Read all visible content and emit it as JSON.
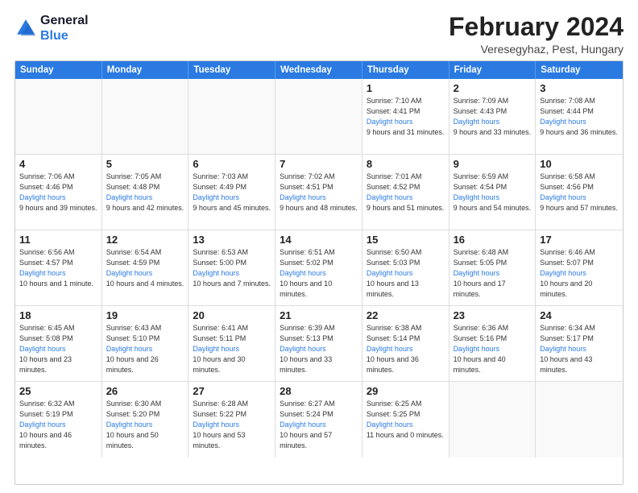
{
  "logo": {
    "line1": "General",
    "line2": "Blue"
  },
  "title": "February 2024",
  "subtitle": "Veresegyhaz, Pest, Hungary",
  "days_of_week": [
    "Sunday",
    "Monday",
    "Tuesday",
    "Wednesday",
    "Thursday",
    "Friday",
    "Saturday"
  ],
  "weeks": [
    [
      {
        "day": "",
        "sunrise": "",
        "sunset": "",
        "daylight": ""
      },
      {
        "day": "",
        "sunrise": "",
        "sunset": "",
        "daylight": ""
      },
      {
        "day": "",
        "sunrise": "",
        "sunset": "",
        "daylight": ""
      },
      {
        "day": "",
        "sunrise": "",
        "sunset": "",
        "daylight": ""
      },
      {
        "day": "1",
        "sunrise": "Sunrise: 7:10 AM",
        "sunset": "Sunset: 4:41 PM",
        "daylight": "Daylight: 9 hours and 31 minutes."
      },
      {
        "day": "2",
        "sunrise": "Sunrise: 7:09 AM",
        "sunset": "Sunset: 4:43 PM",
        "daylight": "Daylight: 9 hours and 33 minutes."
      },
      {
        "day": "3",
        "sunrise": "Sunrise: 7:08 AM",
        "sunset": "Sunset: 4:44 PM",
        "daylight": "Daylight: 9 hours and 36 minutes."
      }
    ],
    [
      {
        "day": "4",
        "sunrise": "Sunrise: 7:06 AM",
        "sunset": "Sunset: 4:46 PM",
        "daylight": "Daylight: 9 hours and 39 minutes."
      },
      {
        "day": "5",
        "sunrise": "Sunrise: 7:05 AM",
        "sunset": "Sunset: 4:48 PM",
        "daylight": "Daylight: 9 hours and 42 minutes."
      },
      {
        "day": "6",
        "sunrise": "Sunrise: 7:03 AM",
        "sunset": "Sunset: 4:49 PM",
        "daylight": "Daylight: 9 hours and 45 minutes."
      },
      {
        "day": "7",
        "sunrise": "Sunrise: 7:02 AM",
        "sunset": "Sunset: 4:51 PM",
        "daylight": "Daylight: 9 hours and 48 minutes."
      },
      {
        "day": "8",
        "sunrise": "Sunrise: 7:01 AM",
        "sunset": "Sunset: 4:52 PM",
        "daylight": "Daylight: 9 hours and 51 minutes."
      },
      {
        "day": "9",
        "sunrise": "Sunrise: 6:59 AM",
        "sunset": "Sunset: 4:54 PM",
        "daylight": "Daylight: 9 hours and 54 minutes."
      },
      {
        "day": "10",
        "sunrise": "Sunrise: 6:58 AM",
        "sunset": "Sunset: 4:56 PM",
        "daylight": "Daylight: 9 hours and 57 minutes."
      }
    ],
    [
      {
        "day": "11",
        "sunrise": "Sunrise: 6:56 AM",
        "sunset": "Sunset: 4:57 PM",
        "daylight": "Daylight: 10 hours and 1 minute."
      },
      {
        "day": "12",
        "sunrise": "Sunrise: 6:54 AM",
        "sunset": "Sunset: 4:59 PM",
        "daylight": "Daylight: 10 hours and 4 minutes."
      },
      {
        "day": "13",
        "sunrise": "Sunrise: 6:53 AM",
        "sunset": "Sunset: 5:00 PM",
        "daylight": "Daylight: 10 hours and 7 minutes."
      },
      {
        "day": "14",
        "sunrise": "Sunrise: 6:51 AM",
        "sunset": "Sunset: 5:02 PM",
        "daylight": "Daylight: 10 hours and 10 minutes."
      },
      {
        "day": "15",
        "sunrise": "Sunrise: 6:50 AM",
        "sunset": "Sunset: 5:03 PM",
        "daylight": "Daylight: 10 hours and 13 minutes."
      },
      {
        "day": "16",
        "sunrise": "Sunrise: 6:48 AM",
        "sunset": "Sunset: 5:05 PM",
        "daylight": "Daylight: 10 hours and 17 minutes."
      },
      {
        "day": "17",
        "sunrise": "Sunrise: 6:46 AM",
        "sunset": "Sunset: 5:07 PM",
        "daylight": "Daylight: 10 hours and 20 minutes."
      }
    ],
    [
      {
        "day": "18",
        "sunrise": "Sunrise: 6:45 AM",
        "sunset": "Sunset: 5:08 PM",
        "daylight": "Daylight: 10 hours and 23 minutes."
      },
      {
        "day": "19",
        "sunrise": "Sunrise: 6:43 AM",
        "sunset": "Sunset: 5:10 PM",
        "daylight": "Daylight: 10 hours and 26 minutes."
      },
      {
        "day": "20",
        "sunrise": "Sunrise: 6:41 AM",
        "sunset": "Sunset: 5:11 PM",
        "daylight": "Daylight: 10 hours and 30 minutes."
      },
      {
        "day": "21",
        "sunrise": "Sunrise: 6:39 AM",
        "sunset": "Sunset: 5:13 PM",
        "daylight": "Daylight: 10 hours and 33 minutes."
      },
      {
        "day": "22",
        "sunrise": "Sunrise: 6:38 AM",
        "sunset": "Sunset: 5:14 PM",
        "daylight": "Daylight: 10 hours and 36 minutes."
      },
      {
        "day": "23",
        "sunrise": "Sunrise: 6:36 AM",
        "sunset": "Sunset: 5:16 PM",
        "daylight": "Daylight: 10 hours and 40 minutes."
      },
      {
        "day": "24",
        "sunrise": "Sunrise: 6:34 AM",
        "sunset": "Sunset: 5:17 PM",
        "daylight": "Daylight: 10 hours and 43 minutes."
      }
    ],
    [
      {
        "day": "25",
        "sunrise": "Sunrise: 6:32 AM",
        "sunset": "Sunset: 5:19 PM",
        "daylight": "Daylight: 10 hours and 46 minutes."
      },
      {
        "day": "26",
        "sunrise": "Sunrise: 6:30 AM",
        "sunset": "Sunset: 5:20 PM",
        "daylight": "Daylight: 10 hours and 50 minutes."
      },
      {
        "day": "27",
        "sunrise": "Sunrise: 6:28 AM",
        "sunset": "Sunset: 5:22 PM",
        "daylight": "Daylight: 10 hours and 53 minutes."
      },
      {
        "day": "28",
        "sunrise": "Sunrise: 6:27 AM",
        "sunset": "Sunset: 5:24 PM",
        "daylight": "Daylight: 10 hours and 57 minutes."
      },
      {
        "day": "29",
        "sunrise": "Sunrise: 6:25 AM",
        "sunset": "Sunset: 5:25 PM",
        "daylight": "Daylight: 11 hours and 0 minutes."
      },
      {
        "day": "",
        "sunrise": "",
        "sunset": "",
        "daylight": ""
      },
      {
        "day": "",
        "sunrise": "",
        "sunset": "",
        "daylight": ""
      }
    ]
  ]
}
